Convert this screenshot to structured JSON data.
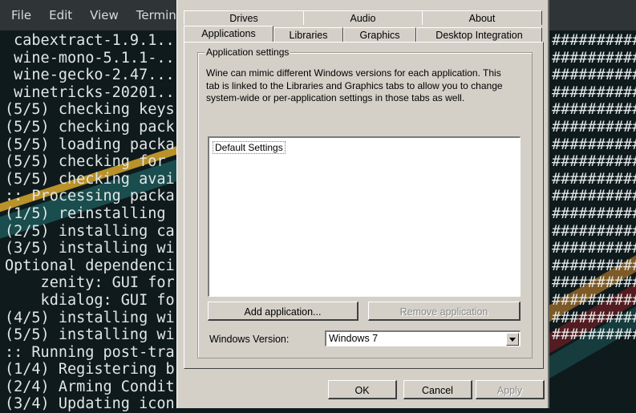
{
  "terminal": {
    "menu": [
      "File",
      "Edit",
      "View",
      "Terminal"
    ],
    "lines": [
      " cabextract-1.9.1...",
      " wine-mono-5.1.1-...",
      " wine-gecko-2.47...",
      " winetricks-20201...",
      "(5/5) checking keys",
      "(5/5) checking pack",
      "(5/5) loading packa",
      "(5/5) checking for",
      "(5/5) checking avai",
      ":: Processing packa",
      "(1/5) reinstalling",
      "(2/5) installing ca",
      "(3/5) installing wi",
      "Optional dependenci",
      "    zenity: GUI for",
      "    kdialog: GUI fo",
      "(4/5) installing wi",
      "(5/5) installing wi",
      ":: Running post-tra",
      "(1/4) Registering b",
      "(2/4) Arming Condit",
      "(3/4) Updating icon"
    ],
    "hash_rows": 18,
    "hash_text": "##########"
  },
  "dialog": {
    "tabs_top": [
      "Drives",
      "Audio",
      "About"
    ],
    "tabs_bottom": [
      "Applications",
      "Libraries",
      "Graphics",
      "Desktop Integration"
    ],
    "group_title": "Application settings",
    "description": [
      "Wine can mimic different Windows versions for each application. This",
      "tab is linked to the Libraries and Graphics tabs to allow you to change",
      "system-wide or per-application settings in those tabs as well."
    ],
    "list_items": [
      "Default Settings"
    ],
    "add_button": "Add application...",
    "remove_button": "Remove application",
    "windows_version_label": "Windows Version:",
    "windows_version_value": "Windows 7",
    "ok": "OK",
    "cancel": "Cancel",
    "apply": "Apply"
  }
}
